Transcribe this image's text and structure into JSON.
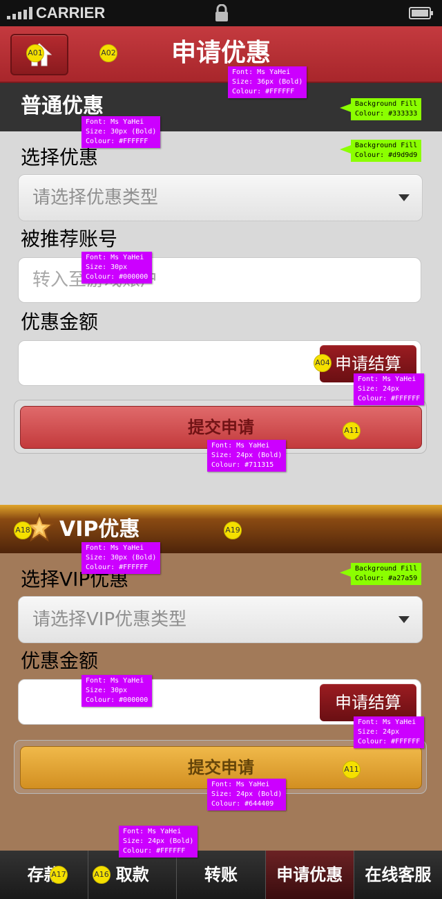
{
  "status_bar": {
    "carrier": "CARRIER"
  },
  "header": {
    "title": "申请优惠"
  },
  "regular_section": {
    "title": "普通优惠",
    "select_label": "选择优惠",
    "select_placeholder": "请选择优惠类型",
    "account_label": "被推荐账号",
    "account_placeholder": "转入至游戏账户",
    "amount_label": "优惠金额",
    "calc_button": "申请结算",
    "submit_button": "提交申请"
  },
  "vip_section": {
    "title": "VIP优惠",
    "select_label": "选择VIP优惠",
    "select_placeholder": "请选择VIP优惠类型",
    "amount_label": "优惠金额",
    "calc_button": "申请结算",
    "submit_button": "提交申请"
  },
  "tab_bar": {
    "tabs": [
      {
        "label": "存款"
      },
      {
        "label": "取款"
      },
      {
        "label": "转账"
      },
      {
        "label": "申请优惠"
      },
      {
        "label": "在线客服"
      }
    ]
  },
  "annotations": {
    "markers": [
      "A01",
      "A02",
      "A04",
      "A11",
      "A11",
      "A18",
      "A19",
      "A17",
      "A16"
    ],
    "notes": [
      {
        "font": "Font: Ms YaHei",
        "size": "Size: 36px (Bold)",
        "colour": "Colour: #FFFFFF"
      },
      {
        "font": "Font: Ms YaHei",
        "size": "Size: 30px (Bold)",
        "colour": "Colour: #FFFFFF"
      },
      {
        "font": "Font: Ms YaHei",
        "size": "Size: 30px",
        "colour": "Colour: #000000"
      },
      {
        "font": "Font: Ms YaHei",
        "size": "Size: 24px",
        "colour": "Colour: #FFFFFF"
      },
      {
        "font": "Font: Ms YaHei",
        "size": "Size: 24px (Bold)",
        "colour": "Colour: #711315"
      },
      {
        "font": "Font: Ms YaHei",
        "size": "Size: 30px (Bold)",
        "colour": "Colour: #FFFFFF"
      },
      {
        "font": "Font: Ms YaHei",
        "size": "Size: 30px",
        "colour": "Colour: #000000"
      },
      {
        "font": "Font: Ms YaHei",
        "size": "Size: 24px",
        "colour": "Colour: #FFFFFF"
      },
      {
        "font": "Font: Ms YaHei",
        "size": "Size: 24px (Bold)",
        "colour": "Colour: #644409"
      },
      {
        "font": "Font: Ms YaHei",
        "size": "Size: 24px (Bold)",
        "colour": "Colour: #FFFFFF"
      }
    ],
    "fills": [
      {
        "label": "Background Fill",
        "colour": "Colour: #333333"
      },
      {
        "label": "Background Fill",
        "colour": "Colour: #d9d9d9"
      },
      {
        "label": "Background Fill",
        "colour": "Colour: #a27a59"
      }
    ]
  },
  "colors": {
    "title_bar": "#b83035",
    "section_header": "#333333",
    "regular_bg": "#d9d9d9",
    "vip_bg": "#a27a59",
    "submit_red_text": "#711315",
    "submit_gold_text": "#644409"
  },
  "icons": {
    "home": "home-icon",
    "select_arrow": "chevron-down-icon",
    "vip_badge": "star-icon",
    "lock": "lock-icon",
    "battery": "battery-icon",
    "signal": "signal-icon"
  }
}
